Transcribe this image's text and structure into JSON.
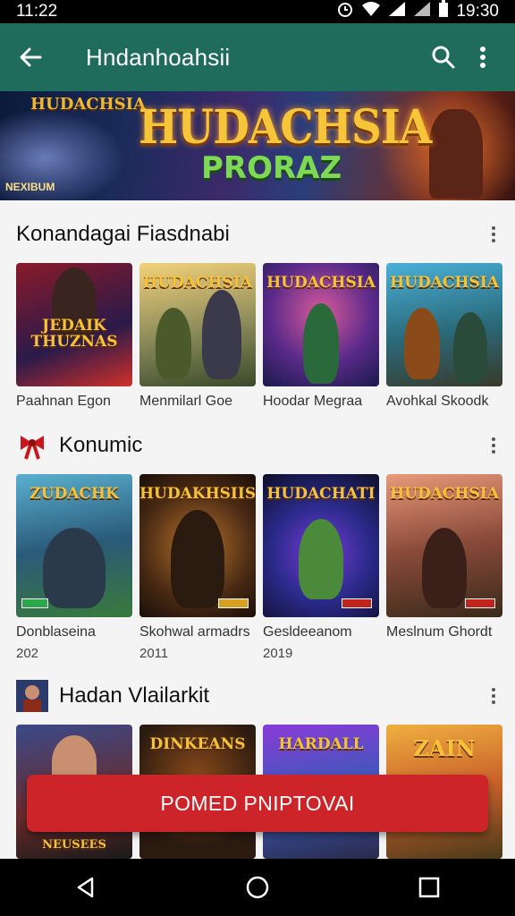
{
  "status": {
    "time_left": "11:22",
    "time_right": "19:30"
  },
  "appbar": {
    "title": "Hndanhoahsii"
  },
  "banner": {
    "title_line1": "HUDACHSIA",
    "title_line2": "PRORAZ",
    "small_logo": "HUDACHSIA",
    "tag": "NEXIBUM"
  },
  "sections": [
    {
      "title": "Konandagai Fiasdnabi",
      "items": [
        {
          "name": "Paahnan Egon",
          "art": "JEDAIK THUZNAS"
        },
        {
          "name": "Menmilarl Goe",
          "art": "HUDACHSIA"
        },
        {
          "name": "Hoodar Megraa",
          "art": "HUDACHSIA"
        },
        {
          "name": "Avohkal Skoodk",
          "art": "HUDACHSIA"
        }
      ]
    },
    {
      "title": "Konumic",
      "items": [
        {
          "name": "Donblaseina",
          "year": "202",
          "art": "ZUDACHK"
        },
        {
          "name": "Skohwal armadrs",
          "year": "2011",
          "art": "HUDAKHSIIS"
        },
        {
          "name": "Gesldeeanom",
          "year": "2019",
          "art": "HUDACHATI"
        },
        {
          "name": "Meslnum Ghordt",
          "year": "",
          "art": "HUDACHSIA"
        }
      ]
    },
    {
      "title": "Hadan Vlailarkit",
      "items": [
        {
          "art": "NEUSEES"
        },
        {
          "art": "DINKEANS"
        },
        {
          "art": "HARDALL"
        },
        {
          "art": "ZAIN"
        }
      ]
    }
  ],
  "floating_button": {
    "label": "POMED PNIPTOVAI"
  },
  "colors": {
    "appbar": "#1f6b5c",
    "accent": "#cc2428"
  }
}
